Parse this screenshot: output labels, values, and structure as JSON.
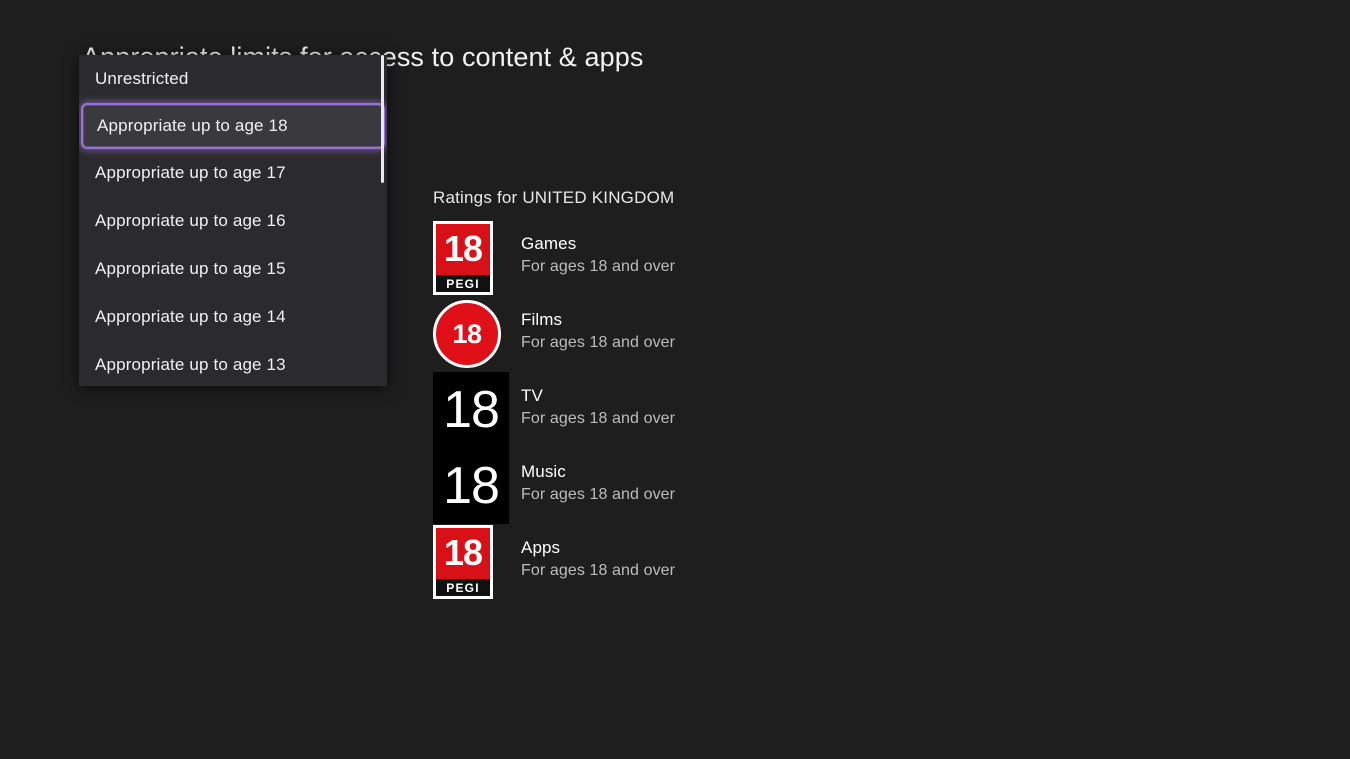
{
  "heading": "Appropriate limits for access to content & apps",
  "dropdown": {
    "name": "age-limit-dropdown",
    "selected_index": 1,
    "scroll_thumb_ratio": 0.39,
    "accent_color": "#9b6fd8",
    "panel_bg": "#2b2b2d",
    "items": [
      {
        "label": "Unrestricted",
        "selected": false
      },
      {
        "label": "Appropriate up to age 18",
        "selected": true
      },
      {
        "label": "Appropriate up to age 17",
        "selected": false
      },
      {
        "label": "Appropriate up to age 16",
        "selected": false
      },
      {
        "label": "Appropriate up to age 15",
        "selected": false
      },
      {
        "label": "Appropriate up to age 14",
        "selected": false
      },
      {
        "label": "Appropriate up to age 13",
        "selected": false
      }
    ]
  },
  "ratings": {
    "heading": "Ratings for UNITED KINGDOM",
    "rows": [
      {
        "category": "Games",
        "description": "For ages 18 and over",
        "badge_type": "pegi",
        "badge_value": "18",
        "badge_word": "PEGI",
        "badge_color": "#d81118",
        "icon_name": "pegi-18-icon"
      },
      {
        "category": "Films",
        "description": "For ages 18 and over",
        "badge_type": "circle",
        "badge_value": "18",
        "badge_color": "#e01018",
        "icon_name": "bbfc-18-icon"
      },
      {
        "category": "TV",
        "description": "For ages 18 and over",
        "badge_type": "tile",
        "badge_value": "18",
        "badge_color": "#000000",
        "icon_name": "tv-18-icon"
      },
      {
        "category": "Music",
        "description": "For ages 18 and over",
        "badge_type": "tile",
        "badge_value": "18",
        "badge_color": "#000000",
        "icon_name": "music-18-icon"
      },
      {
        "category": "Apps",
        "description": "For ages 18 and over",
        "badge_type": "pegi",
        "badge_value": "18",
        "badge_word": "PEGI",
        "badge_color": "#d81118",
        "icon_name": "pegi-18-apps-icon"
      }
    ]
  }
}
